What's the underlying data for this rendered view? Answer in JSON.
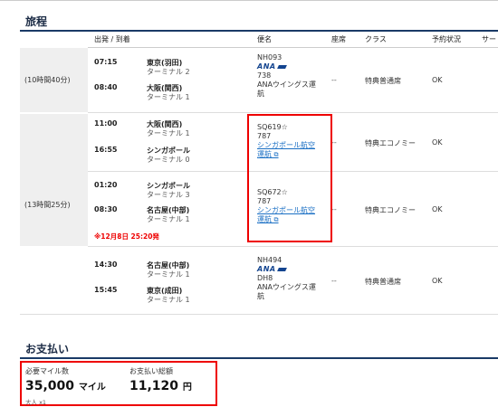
{
  "itinerary": {
    "title": "旅程",
    "headers": {
      "dep_arr": "出発 / 到着",
      "flight": "便名",
      "seat": "座席",
      "class": "クラス",
      "status": "予約状況",
      "service": "サー"
    },
    "journeys": [
      {
        "duration": "(10時間40分)"
      },
      {
        "duration": "(13時間25分)"
      }
    ],
    "segments": [
      {
        "dep_time": "07:15",
        "dep_city": "東京(羽田)",
        "dep_term": "ターミナル 2",
        "arr_time": "08:40",
        "arr_city": "大阪(関西)",
        "arr_term": "ターミナル 1",
        "flight_no": "NH093",
        "carrier_logo": "ANA",
        "aircraft": "738",
        "operator": "ANAウイングス運",
        "operator_2": "航",
        "seat": "--",
        "class": "特典普通席",
        "status": "OK"
      },
      {
        "dep_time": "11:00",
        "dep_city": "大阪(関西)",
        "dep_term": "ターミナル 1",
        "arr_time": "16:55",
        "arr_city": "シンガポール",
        "arr_term": "ターミナル 0",
        "flight_no": "SQ619",
        "aircraft": "787",
        "operator_link": "シンガポール航空",
        "operator_link_2": "運航",
        "seat": "--",
        "class": "特典エコノミー",
        "status": "OK"
      },
      {
        "dep_time": "01:20",
        "dep_city": "シンガポール",
        "dep_term": "ターミナル 3",
        "arr_time": "08:30",
        "arr_city": "名古屋(中部)",
        "arr_term": "ターミナル 1",
        "note": "※12月8日 25:20発",
        "flight_no": "SQ672",
        "aircraft": "787",
        "operator_link": "シンガポール航空",
        "operator_link_2": "運航",
        "seat": "--",
        "class": "特典エコノミー",
        "status": "OK"
      },
      {
        "dep_time": "14:30",
        "dep_city": "名古屋(中部)",
        "dep_term": "ターミナル 1",
        "arr_time": "15:45",
        "arr_city": "東京(成田)",
        "arr_term": "ターミナル 1",
        "flight_no": "NH494",
        "carrier_logo": "ANA",
        "aircraft": "DH8",
        "operator": "ANAウイングス運",
        "operator_2": "航",
        "seat": "--",
        "class": "特典普通席",
        "status": "OK"
      }
    ]
  },
  "payment": {
    "title": "お支払い",
    "miles_label": "必要マイル数",
    "miles_value": "35,000",
    "miles_unit": "マイル",
    "passenger": "大人 x1",
    "total_label": "お支払い総額",
    "total_value": "11,120",
    "total_unit": "円"
  },
  "icons": {
    "star": "☆",
    "external": "⧉"
  },
  "colors": {
    "highlight": "#e00000",
    "link": "#1a6fc4",
    "brand": "#13448f",
    "header_bar": "#1a3a66"
  }
}
